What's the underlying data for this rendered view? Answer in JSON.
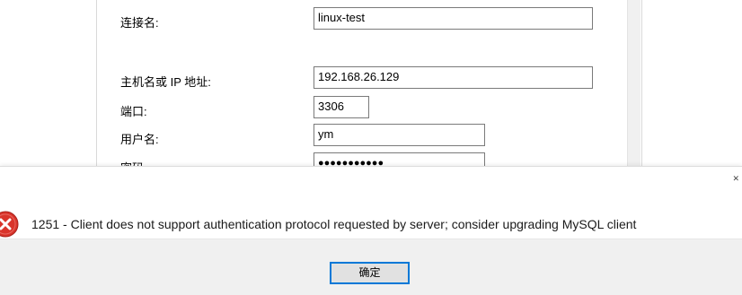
{
  "connection_form": {
    "connection_name_label": "连接名:",
    "connection_name_value": "linux-test",
    "host_label": "主机名或 IP 地址:",
    "host_value": "192.168.26.129",
    "port_label": "端口:",
    "port_value": "3306",
    "username_label": "用户名:",
    "username_value": "ym",
    "password_label": "密码",
    "password_dots": "●●●●●●●●●●●"
  },
  "error_dialog": {
    "icon": "error-x-icon",
    "message": "1251 - Client does not support authentication protocol requested by server; consider upgrading MySQL client",
    "ok_label": "确定",
    "accent_color": "#d9342b"
  }
}
